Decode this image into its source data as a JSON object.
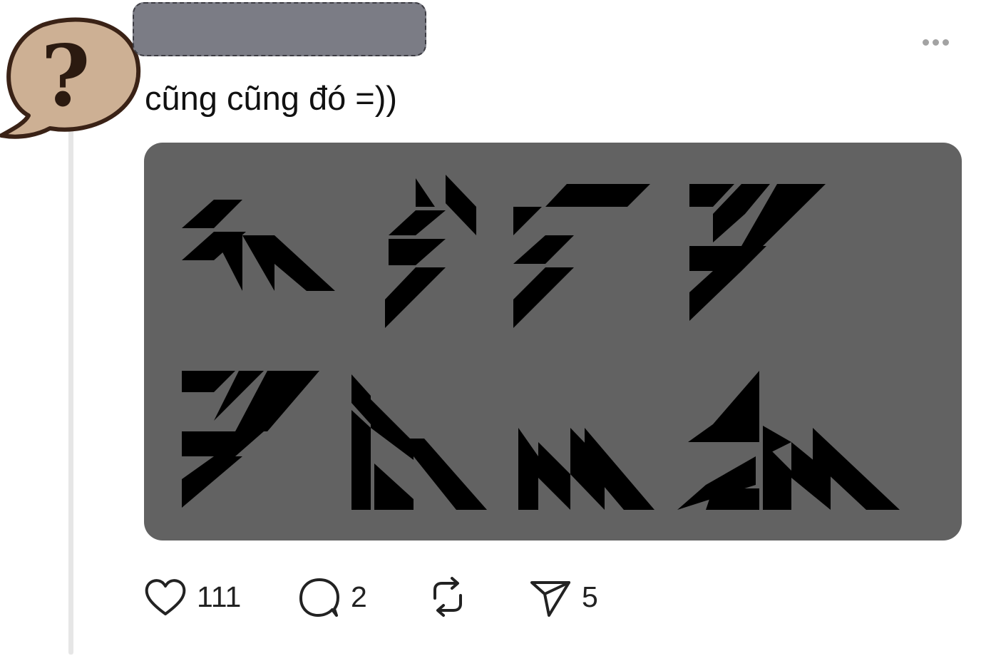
{
  "post": {
    "text": "cũng cũng đó =))",
    "avatar_glyph": "?",
    "colors": {
      "avatar_fill": "#cdb094",
      "avatar_stroke": "#3a2216",
      "media_background": "#626262",
      "glyph_fill": "#000000"
    }
  },
  "actions": {
    "like": {
      "icon": "heart-icon",
      "count": "111"
    },
    "reply": {
      "icon": "speech-bubble-icon",
      "count": "2"
    },
    "repost": {
      "icon": "repost-arrows-icon"
    },
    "share": {
      "icon": "paper-plane-icon",
      "count": "5"
    }
  },
  "more_menu": {
    "icon": "ellipsis-icon"
  }
}
